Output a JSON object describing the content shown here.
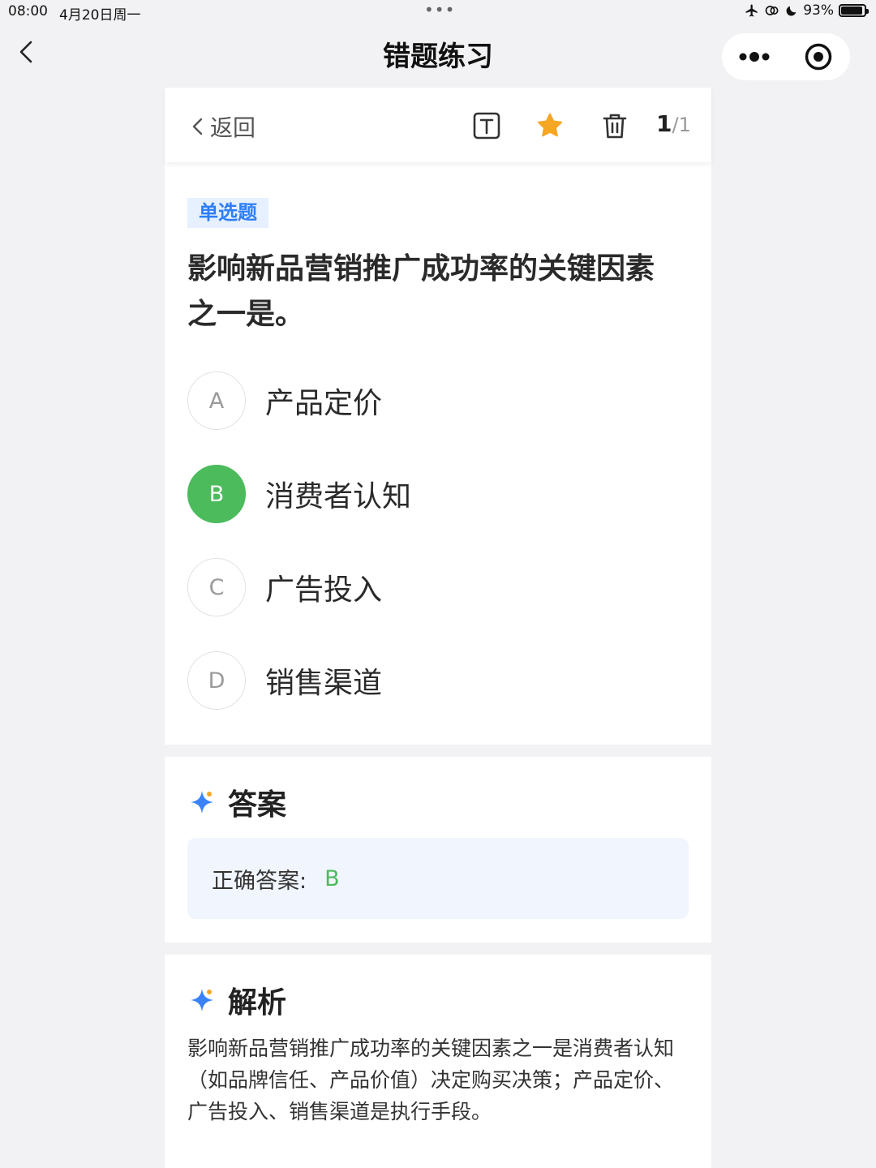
{
  "status_bar": {
    "time": "08:00",
    "date": "4月20日周一",
    "dots": "•••",
    "battery": "93%",
    "battery_level": 0.93
  },
  "nav": {
    "title": "错题练习"
  },
  "toolbar": {
    "back_label": "返回",
    "current": "1",
    "total": "/1",
    "icons": [
      "text-size-icon",
      "star-icon",
      "trash-icon"
    ],
    "star_color": "#f5a623"
  },
  "question": {
    "type": "单选题",
    "text": "影响新品营销推广成功率的关键因素之一是。",
    "options": [
      {
        "letter": "A",
        "text": "产品定价",
        "correct": false
      },
      {
        "letter": "B",
        "text": "消费者认知",
        "correct": true
      },
      {
        "letter": "C",
        "text": "广告投入",
        "correct": false
      },
      {
        "letter": "D",
        "text": "销售渠道",
        "correct": false
      }
    ]
  },
  "answer": {
    "title": "答案",
    "label": "正确答案:",
    "value": "B"
  },
  "analysis": {
    "title": "解析",
    "text": "影响新品营销推广成功率的关键因素之一是消费者认知（如品牌信任、产品价值）决定购买决策；产品定价、广告投入、销售渠道是执行手段。"
  },
  "colors": {
    "accent_blue": "#2d7ef7",
    "correct_green": "#4cbb5c",
    "background": "#f2f2f4"
  }
}
